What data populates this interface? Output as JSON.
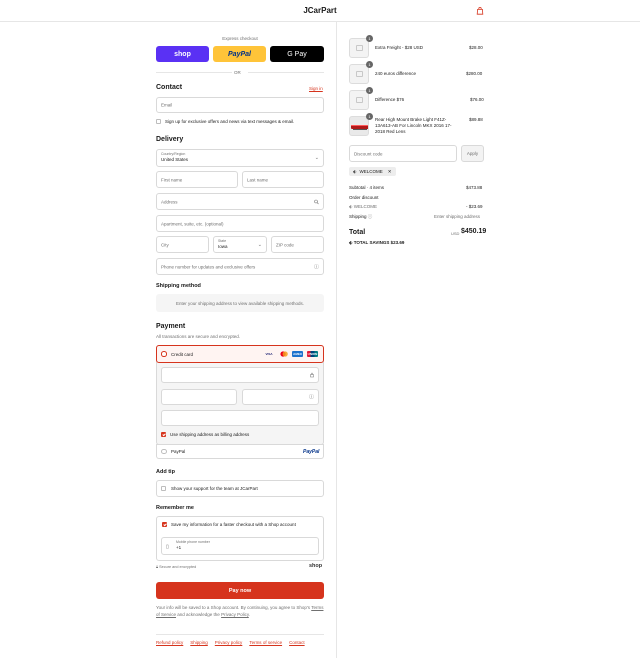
{
  "header": {
    "brand": "JCarPart",
    "cart_icon": "shopping-bag-icon",
    "accent": "#d6341d"
  },
  "express": {
    "title": "Express checkout",
    "shop_label": "shop",
    "paypal_label": "PayPal",
    "gpay_label": "G Pay",
    "or_label": "OR"
  },
  "contact": {
    "heading": "Contact",
    "signin": "Sign in",
    "email_placeholder": "Email",
    "offers_label": "Sign up for exclusive offers and news via text messages & email."
  },
  "delivery": {
    "heading": "Delivery",
    "country_label": "Country/Region",
    "country_value": "United States",
    "first_name": "First name",
    "last_name": "Last name",
    "address": "Address",
    "apartment": "Apartment, suite, etc. (optional)",
    "city": "City",
    "state_label": "State",
    "state_value": "Iowa",
    "zip": "ZIP code",
    "phone": "Phone number for updates and exclusive offers"
  },
  "shipping": {
    "heading": "Shipping method",
    "message": "Enter your shipping address to view available shipping methods."
  },
  "payment": {
    "heading": "Payment",
    "subtitle": "All transactions are secure and encrypted.",
    "credit_card": "Credit card",
    "cards": [
      "VISA",
      "MC",
      "AMEX",
      "UNION"
    ],
    "billing_label": "Use shipping address as billing address",
    "paypal": "PayPal",
    "paypal_logo": "PayPal"
  },
  "tip": {
    "heading": "Add tip",
    "label": "Show your support for the team at JCarPart"
  },
  "remember": {
    "heading": "Remember me",
    "save_label": "Save my information for a faster checkout with a Shop account",
    "mobile_label": "Mobile phone number",
    "mobile_value": "+1",
    "secure": "Secure and encrypted",
    "shop_logo": "shop"
  },
  "pay_now": "Pay now",
  "legal": {
    "text1": "Your info will be saved to a Shop account. By continuing, you agree to Shop's",
    "terms": "Terms of Service",
    "text2": "and acknowledge the",
    "privacy": "Privacy Policy",
    "period": "."
  },
  "footer": [
    "Refund policy",
    "Shipping",
    "Privacy policy",
    "Terms of service",
    "Contact"
  ],
  "cart": {
    "items": [
      {
        "qty": "1",
        "name": "Extra Freight - $28 USD",
        "price": "$28.00"
      },
      {
        "qty": "1",
        "name": "240 euros difference",
        "price": "$280.00"
      },
      {
        "qty": "1",
        "name": "Difference $76",
        "price": "$76.00"
      },
      {
        "qty": "1",
        "name": "Rear High Mount Brake Light F41Z-13A613-AB For Lincoln MKX 2016 17-2018 Red Lens",
        "price": "$89.88"
      }
    ],
    "discount_placeholder": "Discount code",
    "apply": "Apply",
    "tag": "WELCOME",
    "subtotal_label": "Subtotal · 4 items",
    "subtotal": "$473.88",
    "order_discount": "Order discount",
    "discount_code": "WELCOME",
    "discount_amount": "- $23.69",
    "shipping_label": "Shipping",
    "shipping_value": "Enter shipping address",
    "total_label": "Total",
    "currency": "USD",
    "total": "$450.19",
    "savings_label": "TOTAL SAVINGS",
    "savings": "$23.69"
  }
}
